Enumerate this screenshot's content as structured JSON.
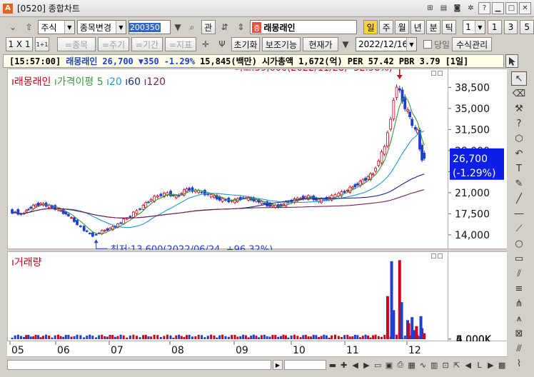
{
  "window": {
    "title": "[0520] 종합차트",
    "app_letter": "A",
    "help_label": "?"
  },
  "toolbar1": {
    "market_type": "주식",
    "change_label": "종목변경",
    "code_value": "200350",
    "gwan_label": "관",
    "stock_badge": "증",
    "stock_name": "래몽래인",
    "periods": [
      "일",
      "주",
      "월",
      "년",
      "분",
      "틱"
    ],
    "active_period_index": 0,
    "count_value": "1",
    "quick_nums": [
      "1",
      "3",
      "5"
    ]
  },
  "toolbar2": {
    "layout_label": "1 X 1",
    "layout_small": "1+1",
    "buttons_disabled": [
      "=종목",
      "=주기",
      "=기간",
      "=지표"
    ],
    "reset_label": "초기화",
    "aux_label": "보조기능",
    "current_label": "현재가",
    "date_value": "2022/12/16",
    "today_label": "당일",
    "formula_label": "수식관리"
  },
  "infobar": {
    "time": "[15:57:00]",
    "name": "래몽래인",
    "price": "26,700",
    "change": "▼350",
    "change_pct": "-1.29%",
    "volume": "15,845(백만)",
    "mcap_label": "시가총액",
    "mcap": "1,672(억)",
    "per": "PER 57.42",
    "pbr": "PBR 3.79",
    "period_tag": "[1일]"
  },
  "legend": {
    "name": "래몽래인",
    "ma_label": "가격이평 5",
    "ma": [
      "20",
      "60",
      "120"
    ]
  },
  "colors": {
    "up": "#d0021b",
    "down": "#1f3fd0",
    "ma5": "#3a9a3a",
    "ma20": "#1e9ad6",
    "ma60": "#1a2b8c",
    "ma120": "#7a1f4f"
  },
  "annotations": {
    "high": "최고:39,600(2022/11/28, -32.58%)",
    "low": "최저:13,600(2022/06/24, +96.32%)"
  },
  "price_axis": {
    "ticks": [
      "38,500",
      "35,000",
      "31,500",
      "28,000",
      "24,500",
      "21,000",
      "17,500",
      "14,000"
    ],
    "current_price": "26,700",
    "current_pct": "(-1.29%)"
  },
  "volume": {
    "title": "거래량",
    "ticks": [
      "6,000K",
      "4,000K",
      "2,000K",
      "0K"
    ]
  },
  "x_axis": {
    "months": [
      "05",
      "06",
      "07",
      "08",
      "09",
      "10",
      "11",
      "12"
    ]
  },
  "chart_data": {
    "type": "candlestick",
    "title": "래몽래인",
    "price_range": [
      11500,
      41500
    ],
    "volume_range": [
      0,
      8000
    ],
    "current_price": 26700,
    "high": {
      "value": 39600,
      "date": "2022/11/28"
    },
    "low": {
      "value": 13600,
      "date": "2022/06/24"
    },
    "months": [
      "05",
      "06",
      "07",
      "08",
      "09",
      "10",
      "11",
      "12"
    ],
    "price_series": [
      [
        "05-02",
        18200
      ],
      [
        "05-04",
        17600
      ],
      [
        "05-06",
        17900
      ],
      [
        "05-10",
        17300
      ],
      [
        "05-13",
        18100
      ],
      [
        "05-18",
        18800
      ],
      [
        "05-23",
        19200
      ],
      [
        "05-27",
        18900
      ],
      [
        "06-02",
        18400
      ],
      [
        "06-08",
        17500
      ],
      [
        "06-13",
        16300
      ],
      [
        "06-17",
        15200
      ],
      [
        "06-22",
        14100
      ],
      [
        "06-24",
        13900
      ],
      [
        "06-29",
        14600
      ],
      [
        "07-05",
        15400
      ],
      [
        "07-08",
        16100
      ],
      [
        "07-13",
        17200
      ],
      [
        "07-18",
        18400
      ],
      [
        "07-22",
        19600
      ],
      [
        "07-27",
        20500
      ],
      [
        "08-01",
        20900
      ],
      [
        "08-05",
        20300
      ],
      [
        "08-10",
        21600
      ],
      [
        "08-16",
        21200
      ],
      [
        "08-22",
        20500
      ],
      [
        "08-26",
        19900
      ],
      [
        "09-01",
        19600
      ],
      [
        "09-07",
        20200
      ],
      [
        "09-14",
        19700
      ],
      [
        "09-20",
        19000
      ],
      [
        "09-26",
        18700
      ],
      [
        "09-30",
        19300
      ],
      [
        "10-06",
        20000
      ],
      [
        "10-12",
        20300
      ],
      [
        "10-18",
        19700
      ],
      [
        "10-24",
        20100
      ],
      [
        "10-28",
        20600
      ],
      [
        "11-02",
        21200
      ],
      [
        "11-07",
        22200
      ],
      [
        "11-11",
        23000
      ],
      [
        "11-16",
        24200
      ],
      [
        "11-22",
        28600
      ],
      [
        "11-25",
        33500
      ],
      [
        "11-28",
        38900
      ],
      [
        "12-01",
        35200
      ],
      [
        "12-05",
        33600
      ],
      [
        "12-08",
        31900
      ],
      [
        "12-12",
        31100
      ],
      [
        "12-14",
        28400
      ],
      [
        "12-16",
        26700
      ]
    ],
    "volume_series": [
      [
        "11-22",
        4300
      ],
      [
        "11-24",
        7800
      ],
      [
        "11-25",
        2900
      ],
      [
        "11-28",
        7900
      ],
      [
        "11-29",
        3700
      ],
      [
        "12-01",
        1900
      ],
      [
        "12-02",
        1600
      ],
      [
        "12-05",
        2200
      ],
      [
        "12-07",
        900
      ],
      [
        "12-09",
        1300
      ],
      [
        "12-13",
        2300
      ],
      [
        "12-14",
        1100
      ],
      [
        "12-16",
        600
      ]
    ]
  }
}
